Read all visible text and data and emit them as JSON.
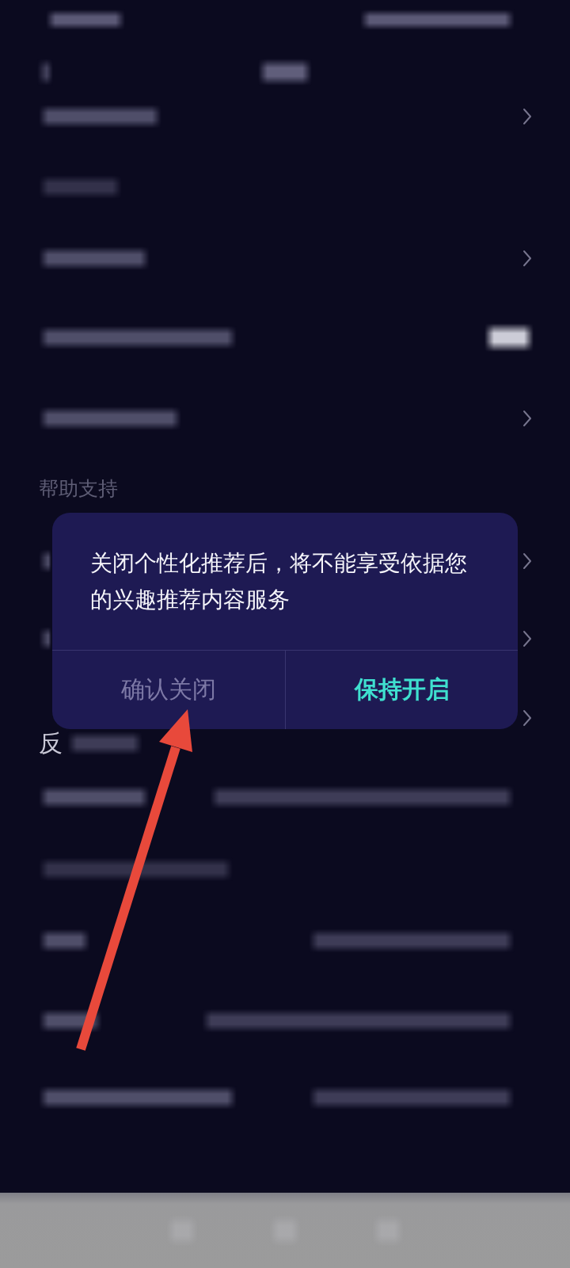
{
  "background": {
    "section_header": "帮助支持",
    "row_label_fragment": "反"
  },
  "dialog": {
    "message": "关闭个性化推荐后，将不能享受依据您的兴趣推荐内容服务",
    "buttons": [
      {
        "label": "确认关闭",
        "kind": "secondary"
      },
      {
        "label": "保持开启",
        "kind": "primary"
      }
    ]
  }
}
